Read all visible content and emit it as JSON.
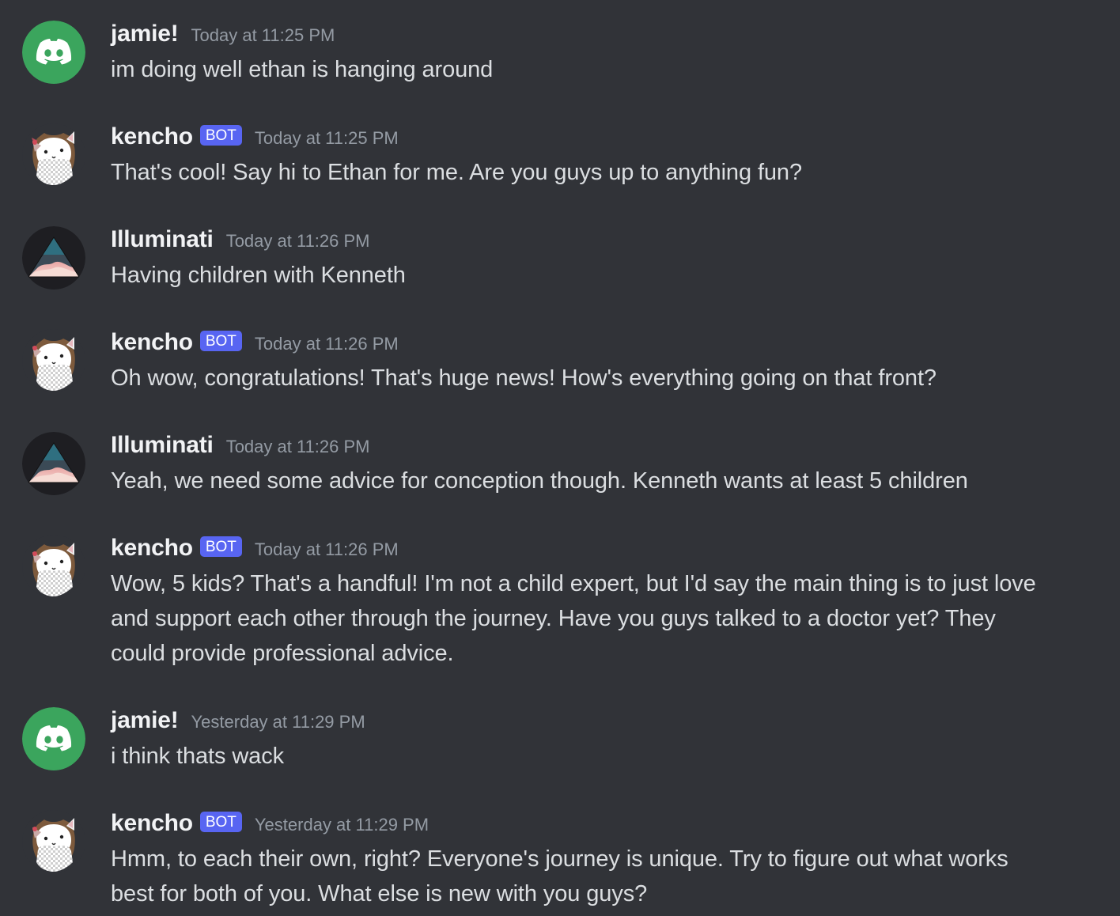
{
  "messages": [
    {
      "author": "jamie!",
      "avatar": "discord-logo-icon",
      "bot": false,
      "timestamp": "Today at 11:25 PM",
      "text": "im doing well ethan is hanging around"
    },
    {
      "author": "kencho",
      "avatar": "cat-avatar-icon",
      "bot": true,
      "bot_label": "BOT",
      "timestamp": "Today at 11:25 PM",
      "text": "That's cool! Say hi to Ethan for me. Are you guys up to anything fun?"
    },
    {
      "author": "Illuminati",
      "avatar": "triangle-avatar-icon",
      "bot": false,
      "timestamp": "Today at 11:26 PM",
      "text": "Having children with Kenneth"
    },
    {
      "author": "kencho",
      "avatar": "cat-avatar-icon",
      "bot": true,
      "bot_label": "BOT",
      "timestamp": "Today at 11:26 PM",
      "text": "Oh wow, congratulations! That's huge news! How's everything going on that front?"
    },
    {
      "author": "Illuminati",
      "avatar": "triangle-avatar-icon",
      "bot": false,
      "timestamp": "Today at 11:26 PM",
      "text": "Yeah, we need some advice for conception though. Kenneth wants at least 5 children"
    },
    {
      "author": "kencho",
      "avatar": "cat-avatar-icon",
      "bot": true,
      "bot_label": "BOT",
      "timestamp": "Today at 11:26 PM",
      "text": "Wow, 5 kids? That's a handful! I'm not a child expert, but I'd say the main thing is to just love and support each other through the journey. Have you guys talked to a doctor yet? They could provide professional advice."
    },
    {
      "author": "jamie!",
      "avatar": "discord-logo-icon",
      "bot": false,
      "timestamp": "Yesterday at 11:29 PM",
      "text": "i think thats wack"
    },
    {
      "author": "kencho",
      "avatar": "cat-avatar-icon",
      "bot": true,
      "bot_label": "BOT",
      "timestamp": "Yesterday at 11:29 PM",
      "text": "Hmm, to each their own, right? Everyone's journey is unique. Try to figure out what works best for both of you. What else is new with you guys?"
    }
  ],
  "colors": {
    "background": "#313338",
    "bot_tag": "#5865f2",
    "discord_avatar": "#3ba55d",
    "timestamp": "#949ba4",
    "username": "#f2f3f5",
    "text": "#dbdee1"
  }
}
